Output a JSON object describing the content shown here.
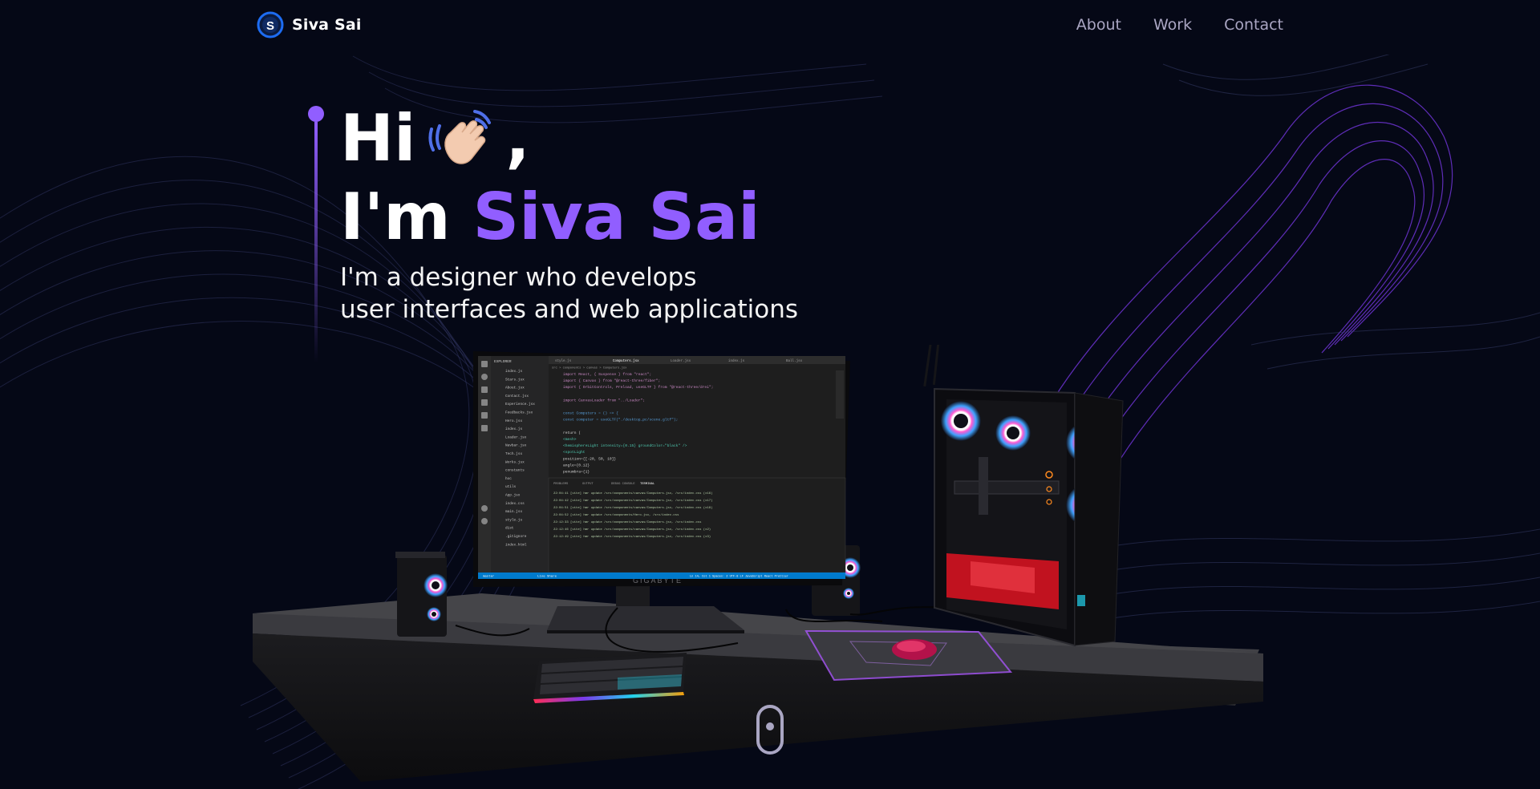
{
  "brand": {
    "name": "Siva Sai",
    "logo_icon": "siva-logo-icon",
    "logo_letter": "S"
  },
  "nav": {
    "links": [
      "About",
      "Work",
      "Contact"
    ]
  },
  "hero": {
    "greeting": "Hi",
    "wave_icon": "waving-hand-icon",
    "comma": ",",
    "intro": "I'm",
    "name": "Siva Sai",
    "subtitle_line1": "I'm a designer who develops",
    "subtitle_line2": "user interfaces and web applications"
  },
  "scene": {
    "monitor_brand": "GIGABYTE",
    "editor": {
      "tabs": [
        "style.js",
        "Computers.jsx",
        "Loader.jsx",
        "index.js",
        "Ball.jsx"
      ],
      "breadcrumb": "src > components > canvas > Computers.jsx",
      "explorer_title": "EXPLORER",
      "files": [
        "index.js",
        "Stars.jsx",
        "About.jsx",
        "Contact.jsx",
        "Experience.jsx",
        "Feedbacks.jsx",
        "Hero.jsx",
        "index.js",
        "Loader.jsx",
        "Navbar.jsx",
        "Tech.jsx",
        "Works.jsx",
        "constants",
        "hoc",
        "utils",
        "App.jsx",
        "index.css",
        "main.jsx",
        "style.js",
        "dist",
        ".gitignore",
        "index.html"
      ],
      "code_lines": [
        "import React, { Suspense } from \"react\";",
        "import { Canvas } from \"@react-three/fiber\";",
        "import { OrbitControls, Preload, useGLTF } from \"@react-three/drei\";",
        "",
        "import CanvasLoader from \"../Loader\";",
        "",
        "const Computers = () => {",
        "  const computer = useGLTF(\"./desktop_pc/scene.gltf\");",
        "",
        "  return (",
        "    <mesh>",
        "      <hemisphereLight intensity={0.15} groundColor=\"black\" />",
        "      <spotLight",
        "        position={[-20, 50, 10]}",
        "        angle={0.12}",
        "        penumbra={1}"
      ],
      "panel_tabs": [
        "PROBLEMS",
        "OUTPUT",
        "DEBUG CONSOLE",
        "TERMINAL"
      ],
      "terminal_lines": [
        "22:04:41 [vite] hmr update /src/components/canvas/Computers.jsx, /src/index.css (x16)",
        "22:04:42 [vite] hmr update /src/components/canvas/Computers.jsx, /src/index.css (x17)",
        "22:04:51 [vite] hmr update /src/components/canvas/Computers.jsx, /src/index.css (x18)",
        "22:04:52 [vite] hmr update /src/components/Hero.jsx, /src/index.css",
        "22:12:33 [vite] hmr update /src/components/canvas/Computers.jsx, /src/index.css",
        "22:12:46 [vite] hmr update /src/components/canvas/Computers.jsx, /src/index.css (x2)",
        "22:12:49 [vite] hmr update /src/components/canvas/Computers.jsx, /src/index.css (x3)"
      ],
      "status_left": "master",
      "status_live": "Live Share",
      "status_right": "Ln 14, Col 1   Spaces: 2   UTF-8   LF   JavaScript React   Prettier"
    }
  },
  "scroll_indicator": {
    "icon": "mouse-scroll-icon"
  },
  "colors": {
    "background": "#050816",
    "accent": "#915eff",
    "nav_text": "#aaa6c3",
    "wave": "#7c3aed"
  }
}
